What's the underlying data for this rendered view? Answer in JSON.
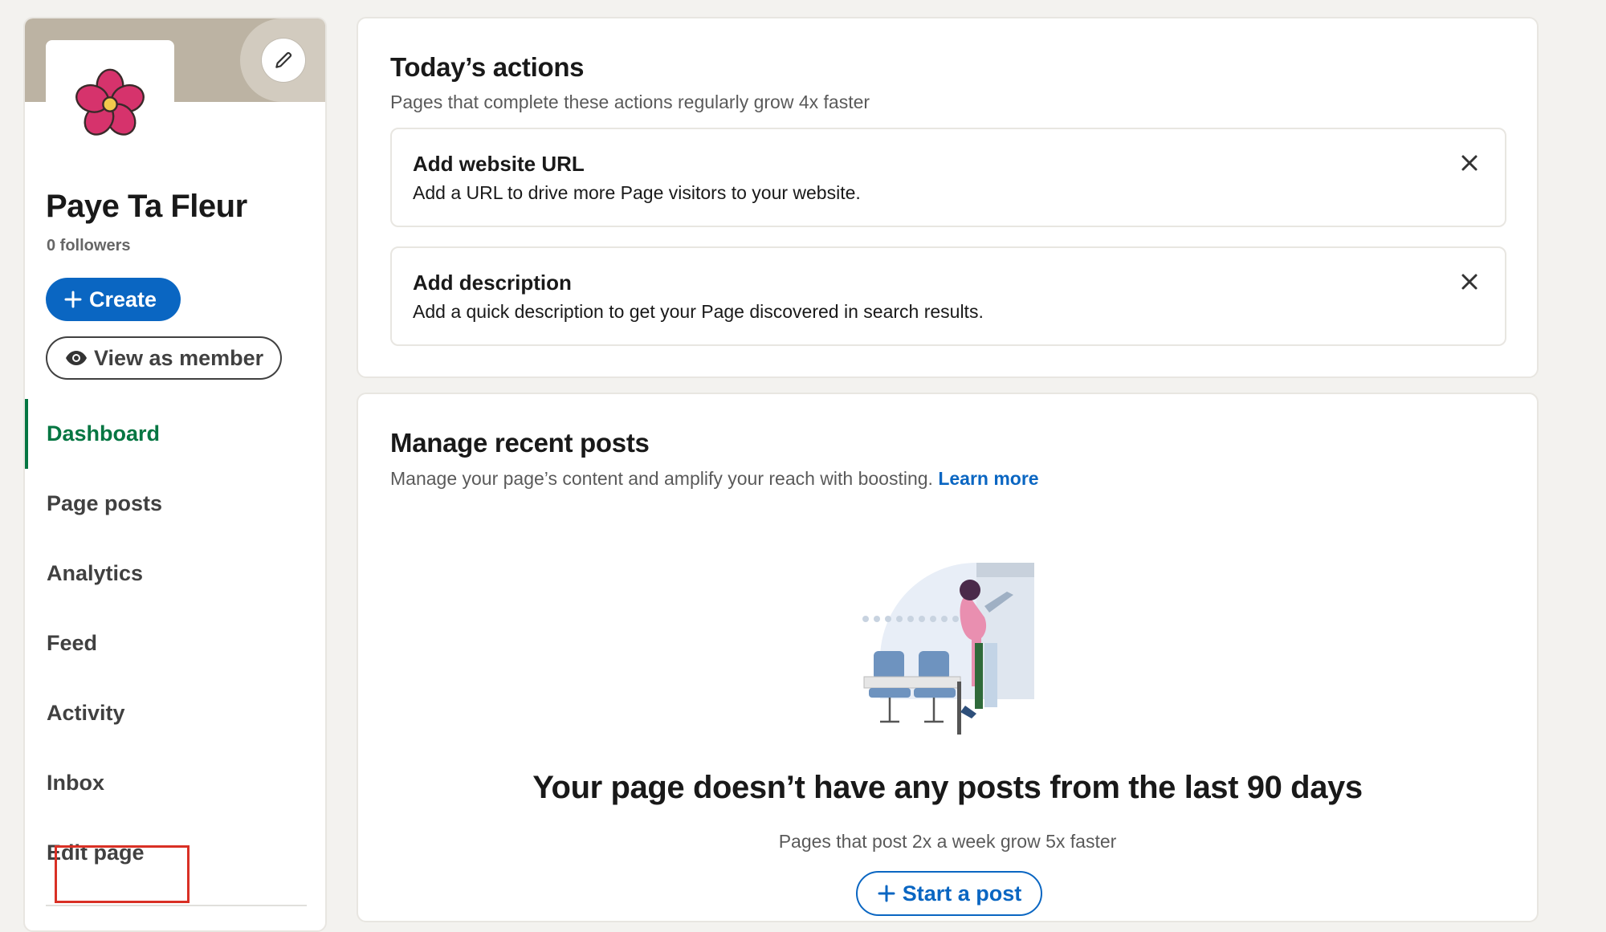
{
  "sidebar": {
    "org_name": "Paye Ta Fleur",
    "followers": "0 followers",
    "create_label": "Create",
    "view_label": "View as member",
    "nav": [
      {
        "label": "Dashboard",
        "active": true
      },
      {
        "label": "Page posts"
      },
      {
        "label": "Analytics"
      },
      {
        "label": "Feed"
      },
      {
        "label": "Activity"
      },
      {
        "label": "Inbox"
      },
      {
        "label": "Edit page",
        "highlighted": true
      }
    ]
  },
  "actions": {
    "title": "Today’s actions",
    "subtitle": "Pages that complete these actions regularly grow 4x faster",
    "items": [
      {
        "title": "Add website URL",
        "desc": "Add a URL to drive more Page visitors to your website."
      },
      {
        "title": "Add description",
        "desc": "Add a quick description to get your Page discovered in search results."
      }
    ]
  },
  "posts": {
    "title": "Manage recent posts",
    "subtitle": "Manage your page’s content and amplify your reach with boosting.",
    "learn_more": "Learn more",
    "empty_title": "Your page doesn’t have any posts from the last 90 days",
    "empty_sub": "Pages that post 2x a week grow 5x faster",
    "start_label": "Start a post"
  },
  "colors": {
    "brand_blue": "#0a66c2",
    "active_green": "#057642",
    "highlight_red": "#d93025",
    "flower_pink": "#d6336c"
  },
  "icons": [
    "pencil-icon",
    "flower-logo",
    "plus-icon",
    "eye-icon",
    "close-icon"
  ]
}
